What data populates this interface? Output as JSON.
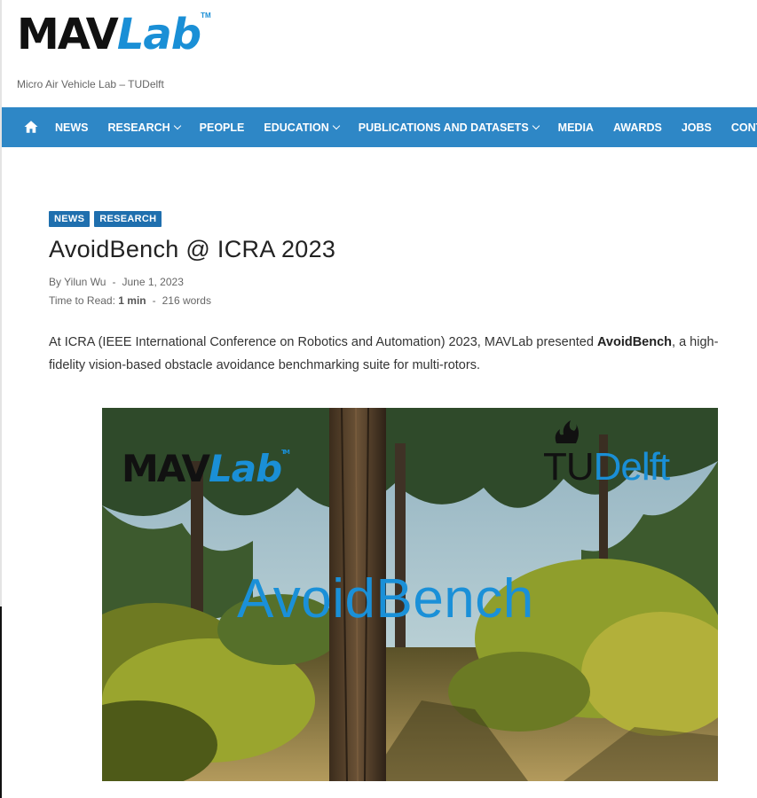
{
  "site": {
    "logo_main": "MAV",
    "logo_accent": "Lab",
    "logo_tm": "TM",
    "tagline": "Micro Air Vehicle Lab – TUDelft"
  },
  "nav": {
    "home_icon": "home-icon",
    "items": [
      {
        "label": "NEWS",
        "dropdown": false
      },
      {
        "label": "RESEARCH",
        "dropdown": true
      },
      {
        "label": "PEOPLE",
        "dropdown": false
      },
      {
        "label": "EDUCATION",
        "dropdown": true
      },
      {
        "label": "PUBLICATIONS AND DATASETS",
        "dropdown": true
      },
      {
        "label": "MEDIA",
        "dropdown": false
      },
      {
        "label": "AWARDS",
        "dropdown": false
      },
      {
        "label": "JOBS",
        "dropdown": false
      },
      {
        "label": "CONTACT",
        "dropdown": false
      }
    ],
    "bg_color": "#2e87c6"
  },
  "article": {
    "categories": [
      "NEWS",
      "RESEARCH"
    ],
    "title": "AvoidBench @ ICRA 2023",
    "author": "By Yilun Wu",
    "date": "June 1, 2023",
    "read_time_label": "Time to Read:",
    "read_time_value": "1 min",
    "word_count": "216 words",
    "separator": "-",
    "intro_before": "At ICRA (IEEE International Conference on Robotics and Automation) 2023, MAVLab presented ",
    "intro_bold": "AvoidBench",
    "intro_after": ", a high-fidelity vision-based obstacle avoidance benchmarking suite for multi-rotors."
  },
  "hero": {
    "logo_main": "MAV",
    "logo_accent": "Lab",
    "logo_tm": "TM",
    "partner_a": "TU",
    "partner_b": "Delft",
    "title": "AvoidBench"
  }
}
